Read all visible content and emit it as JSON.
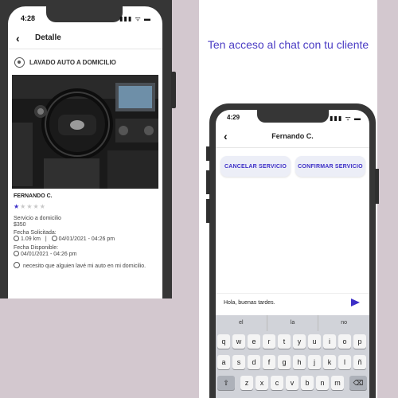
{
  "left_phone": {
    "status_time": "4:28",
    "status_icons": "▮▮▮ ᯤ ▬",
    "nav": {
      "back_icon": "chevron-left-icon",
      "title": "Detalle"
    },
    "service_title": "LAVADO AUTO A DOMICILIO",
    "customer_name": "FERNANDO C.",
    "rating": {
      "value": 1,
      "max": 5
    },
    "service_type": "Servicio a domicilio",
    "price": "$350",
    "requested_label": "Fecha Solicitada:",
    "distance": "1.09 km",
    "separator": "|",
    "requested_date": "04/01/2021 - 04:26 pm",
    "available_label": "Fecha Disponible:",
    "available_date": "04/01/2021 - 04:26 pm",
    "comment": "necesito que alguien lavé mi auto en mi domicilio."
  },
  "promo_text": "Ten acceso al chat con tu cliente",
  "right_phone": {
    "status_time": "4:29",
    "status_icons": "▮▮▮ ᯤ ▬",
    "nav": {
      "back_icon": "chevron-left-icon",
      "title": "Fernando C."
    },
    "cancel_button": "CANCELAR SERVICIO",
    "confirm_button": "CONFIRMAR SERVICIO",
    "message_text": "Hola, buenas tardes.",
    "keyboard": {
      "suggestions": [
        "el",
        "la",
        "no"
      ],
      "row1": [
        "q",
        "w",
        "e",
        "r",
        "t",
        "y",
        "u",
        "i",
        "o",
        "p"
      ],
      "row2": [
        "a",
        "s",
        "d",
        "f",
        "g",
        "h",
        "j",
        "k",
        "l",
        "ñ"
      ],
      "row3": [
        "⇧",
        "z",
        "x",
        "c",
        "v",
        "b",
        "n",
        "m",
        "⌫"
      ]
    }
  },
  "colors": {
    "accent": "#3d2fc7",
    "frame": "#363636",
    "background": "#d3c8cf"
  }
}
